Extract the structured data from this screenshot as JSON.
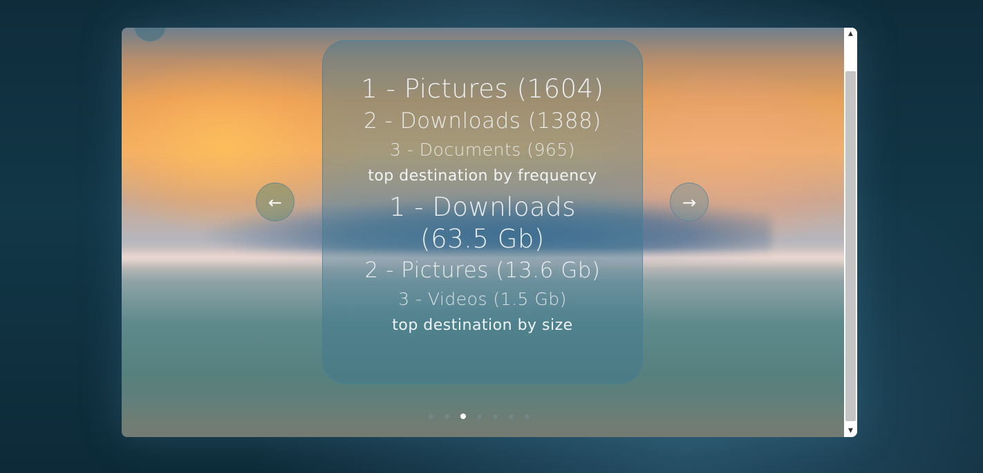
{
  "carousel": {
    "prev_label": "←",
    "next_label": "→",
    "slide": {
      "frequency": [
        "1 - Pictures (1604)",
        "2 - Downloads (1388)",
        "3 - Documents (965)"
      ],
      "frequency_caption": "top destination by frequency",
      "size": [
        "1 - Downloads (63.5 Gb)",
        "2 - Pictures (13.6 Gb)",
        "3 - Videos (1.5 Gb)"
      ],
      "size_caption": "top destination by size"
    },
    "page_count": 7,
    "active_page": 3
  },
  "scrollbar": {
    "up_icon": "▲",
    "down_icon": "▼"
  }
}
